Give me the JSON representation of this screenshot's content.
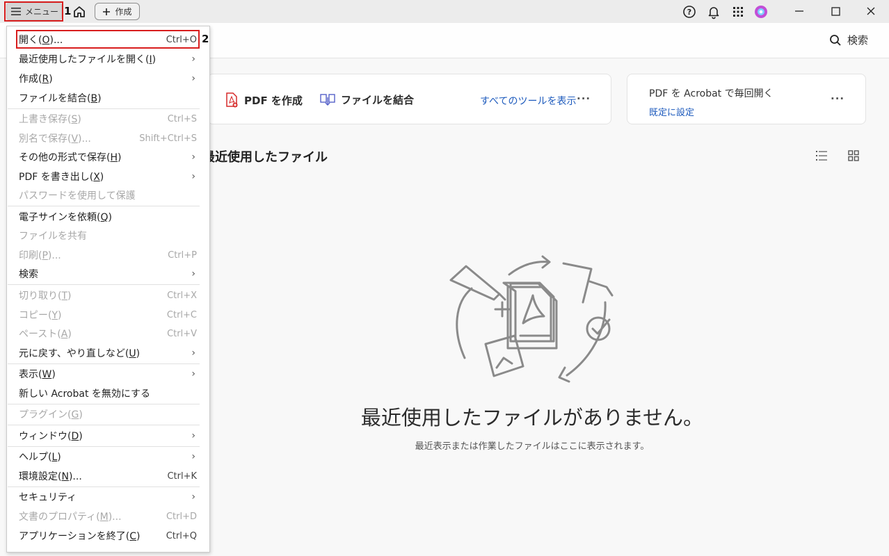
{
  "titlebar": {
    "menu_label": "メニュー",
    "create_label": "作成",
    "step1": "1",
    "step2": "2"
  },
  "topbar": {
    "search_label": "検索"
  },
  "tools": {
    "create_pdf": "PDF を作成",
    "combine": "ファイルを結合",
    "all_tools": "すべてのツールを表示",
    "more": "···"
  },
  "acrobat_card": {
    "title": "PDF を Acrobat で毎回開く",
    "link": "既定に設定",
    "more": "···"
  },
  "recent": {
    "title": "最近使用したファイル",
    "empty_title": "最近使用したファイルがありません。",
    "empty_sub": "最近表示または作業したファイルはここに表示されます。"
  },
  "menu": {
    "items": [
      {
        "label": "開く(",
        "u": "O",
        "tail": ")...",
        "shortcut": "Ctrl+O"
      },
      {
        "label": "最近使用したファイルを開く(",
        "u": "I",
        "tail": ")"
      },
      {
        "label": "作成(",
        "u": "R",
        "tail": ")"
      },
      {
        "label": "ファイルを結合(",
        "u": "B",
        "tail": ")"
      },
      {
        "label": "上書き保存(",
        "u": "S",
        "tail": ")",
        "shortcut": "Ctrl+S"
      },
      {
        "label": "別名で保存(",
        "u": "V",
        "tail": ")...",
        "shortcut": "Shift+Ctrl+S"
      },
      {
        "label": "その他の形式で保存(",
        "u": "H",
        "tail": ")"
      },
      {
        "label": "PDF を書き出し(",
        "u": "X",
        "tail": ")"
      },
      {
        "label": "パスワードを使用して保護",
        "u": "",
        "tail": ""
      },
      {
        "label": "電子サインを依頼(",
        "u": "Q",
        "tail": ")"
      },
      {
        "label": "ファイルを共有",
        "u": "",
        "tail": ""
      },
      {
        "label": "印刷(",
        "u": "P",
        "tail": ")...",
        "shortcut": "Ctrl+P"
      },
      {
        "label": "検索",
        "u": "",
        "tail": ""
      },
      {
        "label": "切り取り(",
        "u": "T",
        "tail": ")",
        "shortcut": "Ctrl+X"
      },
      {
        "label": "コピー(",
        "u": "Y",
        "tail": ")",
        "shortcut": "Ctrl+C"
      },
      {
        "label": "ペースト(",
        "u": "A",
        "tail": ")",
        "shortcut": "Ctrl+V"
      },
      {
        "label": "元に戻す、やり直しなど(",
        "u": "U",
        "tail": ")"
      },
      {
        "label": "表示(",
        "u": "W",
        "tail": ")"
      },
      {
        "label": "新しい Acrobat を無効にする",
        "u": "",
        "tail": ""
      },
      {
        "label": "プラグイン(",
        "u": "G",
        "tail": ")"
      },
      {
        "label": "ウィンドウ(",
        "u": "D",
        "tail": ")"
      },
      {
        "label": "ヘルプ(",
        "u": "L",
        "tail": ")"
      },
      {
        "label": "環境設定(",
        "u": "N",
        "tail": ")...",
        "shortcut": "Ctrl+K"
      },
      {
        "label": "セキュリティ",
        "u": "",
        "tail": ""
      },
      {
        "label": "文書のプロパティ(",
        "u": "M",
        "tail": ")...",
        "shortcut": "Ctrl+D"
      },
      {
        "label": "アプリケーションを終了(",
        "u": "C",
        "tail": ")",
        "shortcut": "Ctrl+Q"
      }
    ]
  }
}
